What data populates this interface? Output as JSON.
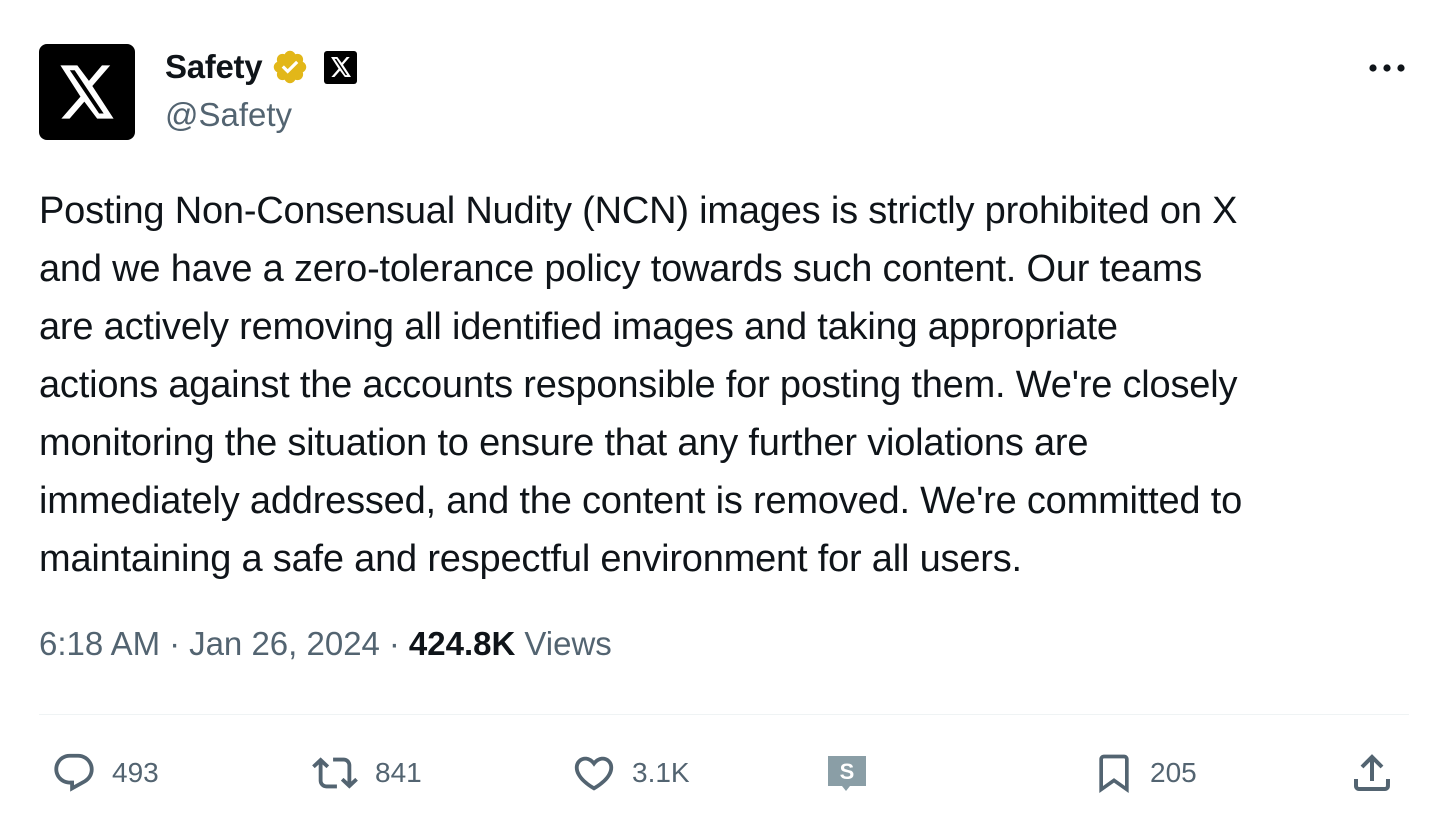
{
  "author": {
    "display_name": "Safety",
    "handle": "@Safety",
    "avatar_icon": "x-logo-icon",
    "verified_badge": "gold-verified-icon",
    "affiliation_badge": "x-affiliate-icon"
  },
  "tweet": {
    "text": "Posting Non-Consensual Nudity (NCN) images is strictly prohibited on X\nand we have a zero-tolerance policy towards such content. Our teams\nare actively removing all identified images and taking appropriate\nactions against the accounts responsible for posting them. We're closely\nmonitoring the situation to ensure that any further violations are\nimmediately addressed, and the content is removed. We're committed to\nmaintaining a safe and respectful environment for all users."
  },
  "meta": {
    "time": "6:18 AM",
    "date": "Jan 26, 2024",
    "separator": "·",
    "views_count": "424.8K",
    "views_label": "Views"
  },
  "actions": {
    "replies": "493",
    "reposts": "841",
    "likes": "3.1K",
    "bookmarks": "205"
  },
  "colors": {
    "text": "#0f1419",
    "secondary": "#536471",
    "gold_badge": "#e2b719",
    "divider": "#eff3f4",
    "extension_icon": "#8a9ea6"
  }
}
